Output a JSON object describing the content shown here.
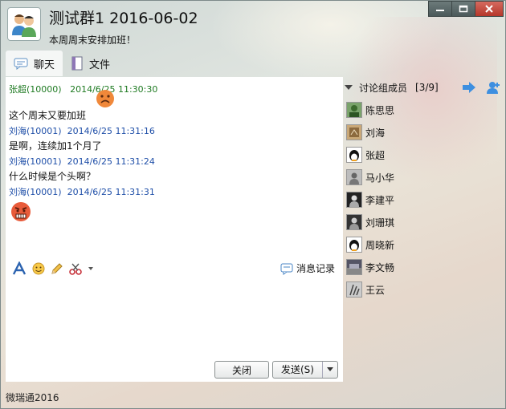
{
  "header": {
    "title": "测试群1  2016-06-02",
    "subtitle": "本周周末安排加班！"
  },
  "tabs": [
    {
      "label": "聊天",
      "icon": "chat-icon"
    },
    {
      "label": "文件",
      "icon": "file-icon"
    }
  ],
  "messages": [
    {
      "sender": "张超(10000)",
      "time": "2014/6/25 11:30:30",
      "text": "这个周末又要加班",
      "emoji": "sad-face"
    },
    {
      "sender": "刘海(10001)",
      "time": "2014/6/25 11:31:16",
      "text": "是啊，连续加1个月了"
    },
    {
      "sender": "刘海(10001)",
      "time": "2014/6/25 11:31:24",
      "text": "什么时候是个头啊？"
    },
    {
      "sender": "刘海(10001)",
      "time": "2014/6/25 11:31:31",
      "text": "",
      "emoji": "angry-face"
    }
  ],
  "toolbar": {
    "history_label": "消息记录"
  },
  "buttons": {
    "close": "关闭",
    "send": "发送(S)"
  },
  "members": {
    "heading": "讨论组成员",
    "count": "[3/9]",
    "list": [
      "陈思思",
      "刘海",
      "张超",
      "马小华",
      "李建平",
      "刘珊琪",
      "周晓新",
      "李文畅",
      "王云"
    ]
  },
  "status": {
    "app_name": "微瑞通2016"
  },
  "colors": {
    "sender_self": "#1e7a21",
    "sender_other": "#1f4fa8"
  }
}
